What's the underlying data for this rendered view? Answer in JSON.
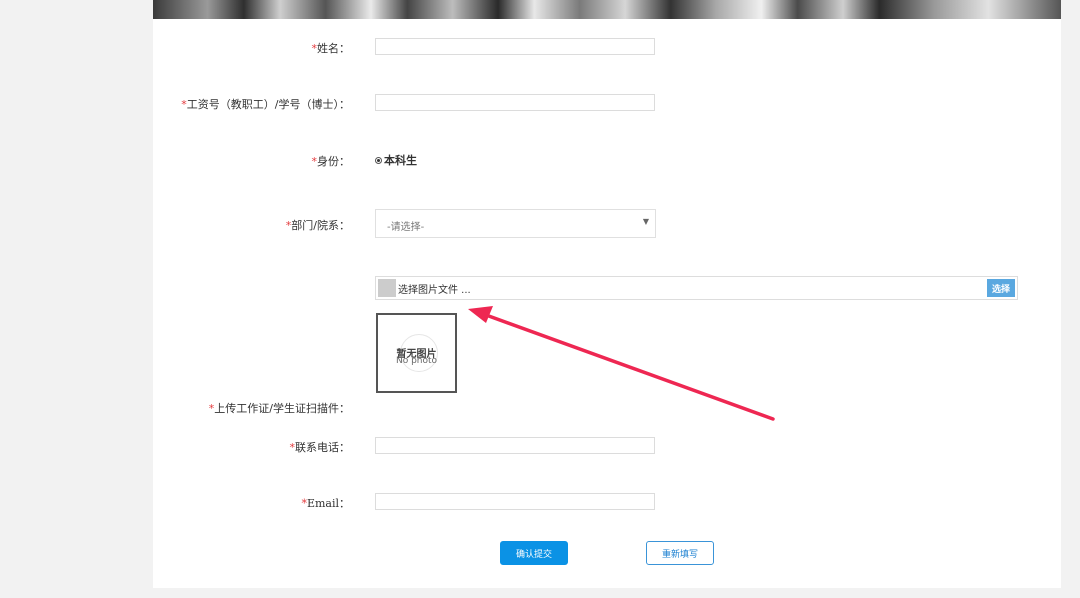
{
  "form": {
    "required_mark": "*",
    "name_label": "姓名：",
    "id_label": "工资号（教职工）/学号（博士）：",
    "identity_label": "身份：",
    "identity_value": "本科生",
    "dept_label": "部门/院系：",
    "dept_placeholder": "-请选择-",
    "file_placeholder": "选择图片文件 ...",
    "file_button": "选择",
    "no_photo_cn": "暂无图片",
    "no_photo_en": "No photo",
    "upload_label": "上传工作证/学生证扫描件：",
    "phone_label": "联系电话：",
    "email_label": "Email：",
    "submit_label": "确认提交",
    "reset_label": "重新填写"
  },
  "colors": {
    "required": "#e4393c",
    "primary_button": "#0b92e5",
    "file_button": "#5aa8e0",
    "annotation_arrow": "#ee2752"
  }
}
